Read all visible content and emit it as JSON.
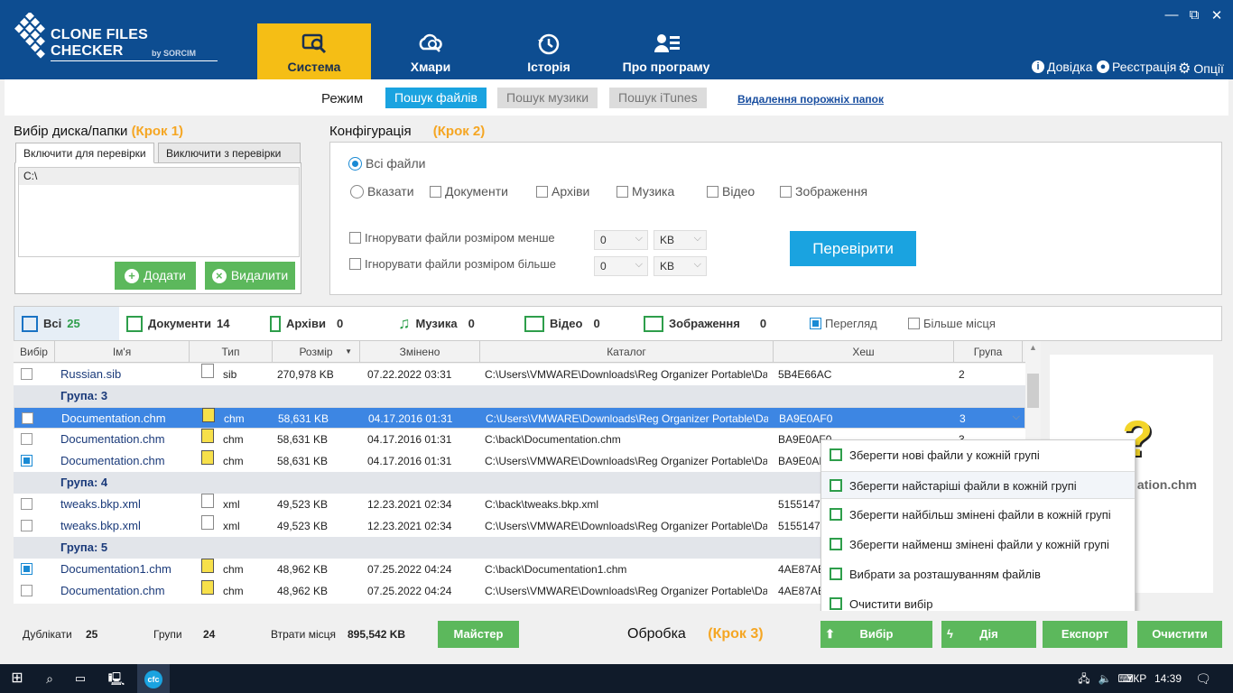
{
  "app": {
    "title": "CLONE FILES CHECKER",
    "subtitle": "by SORCIM"
  },
  "nav": {
    "tabs": [
      {
        "label": "Система",
        "active": true
      },
      {
        "label": "Хмари"
      },
      {
        "label": "Історія"
      },
      {
        "label": "Про програму"
      }
    ]
  },
  "top_links": {
    "help": "Довідка",
    "register": "Реєстрація",
    "options": "Опції"
  },
  "mode": {
    "label": "Режим",
    "buttons": [
      "Пошук файлів",
      "Пошук музики",
      "Пошук iTunes"
    ],
    "link": "Видалення порожніх папок"
  },
  "disk": {
    "title": "Вибір диска/папки",
    "step": "(Крок 1)",
    "tab_include": "Включити для перевірки",
    "tab_exclude": "Виключити з перевірки",
    "paths": [
      "C:\\"
    ],
    "add": "Додати",
    "remove": "Видалити"
  },
  "config": {
    "title": "Конфігурація",
    "step": "(Крок 2)",
    "all_files": "Всі файли",
    "specify": "Вказати",
    "types": [
      "Документи",
      "Архіви",
      "Музика",
      "Відео",
      "Зображення"
    ],
    "ignore_smaller": "Ігнорувати файли розміром менше",
    "ignore_larger": "Ігнорувати файли розміром більше",
    "size_value": "0",
    "size_unit": "KB",
    "scan": "Перевірити"
  },
  "categories": [
    {
      "label": "Всі",
      "count": "25"
    },
    {
      "label": "Документи",
      "count": "14"
    },
    {
      "label": "Архіви",
      "count": "0"
    },
    {
      "label": "Музика",
      "count": "0"
    },
    {
      "label": "Відео",
      "count": "0"
    },
    {
      "label": "Зображення",
      "count": "0"
    }
  ],
  "view": {
    "preview": "Перегляд",
    "more_space": "Більше місця"
  },
  "columns": [
    "Вибір",
    "Ім'я",
    "Тип",
    "Розмір",
    "Змінено",
    "Каталог",
    "Хеш",
    "Група"
  ],
  "rows": [
    {
      "type": "file",
      "checked": false,
      "name": "Russian.sib",
      "ext": "sib",
      "size": "270,978 KB",
      "modified": "07.22.2022 03:31",
      "folder": "C:\\Users\\VMWARE\\Downloads\\Reg Organizer Portable\\Data",
      "hash": "5B4E66AC",
      "group": "2"
    },
    {
      "type": "group",
      "label": "Група: 3"
    },
    {
      "type": "file",
      "checked": false,
      "selected": true,
      "name": "Documentation.chm",
      "ext": "chm",
      "size": "58,631 KB",
      "modified": "04.17.2016 01:31",
      "folder": "C:\\Users\\VMWARE\\Downloads\\Reg Organizer Portable\\Data",
      "hash": "BA9E0AF0",
      "group": "3"
    },
    {
      "type": "file",
      "checked": false,
      "name": "Documentation.chm",
      "ext": "chm",
      "size": "58,631 KB",
      "modified": "04.17.2016 01:31",
      "folder": "C:\\back\\Documentation.chm",
      "hash": "BA9E0AF0",
      "group": "3"
    },
    {
      "type": "file",
      "checked": true,
      "name": "Documentation.chm",
      "ext": "chm",
      "size": "58,631 KB",
      "modified": "04.17.2016 01:31",
      "folder": "C:\\Users\\VMWARE\\Downloads\\Reg Organizer Portable\\Data",
      "hash": "BA9E0AF0",
      "group": "3"
    },
    {
      "type": "group",
      "label": "Група: 4"
    },
    {
      "type": "file",
      "checked": false,
      "name": "tweaks.bkp.xml",
      "ext": "xml",
      "size": "49,523 KB",
      "modified": "12.23.2021 02:34",
      "folder": "C:\\back\\tweaks.bkp.xml",
      "hash": "5155147",
      "group": ""
    },
    {
      "type": "file",
      "checked": false,
      "name": "tweaks.bkp.xml",
      "ext": "xml",
      "size": "49,523 KB",
      "modified": "12.23.2021 02:34",
      "folder": "C:\\Users\\VMWARE\\Downloads\\Reg Organizer Portable\\Data",
      "hash": "5155147",
      "group": ""
    },
    {
      "type": "group",
      "label": "Група: 5"
    },
    {
      "type": "file",
      "checked": true,
      "name": "Documentation1.chm",
      "ext": "chm",
      "size": "48,962 KB",
      "modified": "07.25.2022 04:24",
      "folder": "C:\\back\\Documentation1.chm",
      "hash": "4AE87AE",
      "group": ""
    },
    {
      "type": "file",
      "checked": false,
      "name": "Documentation.chm",
      "ext": "chm",
      "size": "48,962 KB",
      "modified": "07.25.2022 04:24",
      "folder": "C:\\Users\\VMWARE\\Downloads\\Reg Organizer Portable\\Data",
      "hash": "4AE87AE",
      "group": ""
    }
  ],
  "preview": {
    "filename": "ation.chm"
  },
  "context_menu": [
    "Зберегти нові файли у кожній групі",
    "Зберегти найстаріші файли в кожній групі",
    "Зберегти найбільш змінені файли в кожній групі",
    "Зберегти найменш змінені файли у кожній групі",
    "Вибрати за розташуванням файлів",
    "Очистити вибір"
  ],
  "status": {
    "dup_label": "Дублікати",
    "dup_value": "25",
    "groups_label": "Групи",
    "groups_value": "24",
    "loss_label": "Втрати місця",
    "loss_value": "895,542 KB"
  },
  "actions": {
    "wizard": "Майстер",
    "processing": "Обробка",
    "step": "(Крок 3)",
    "select": "Вибір",
    "action": "Дія",
    "export": "Експорт",
    "clear": "Очистити"
  },
  "taskbar": {
    "lang": "УКР",
    "time": "14:39"
  },
  "colors": {
    "header": "#0d4d91",
    "accent": "#f5be15",
    "green": "#5cb85c",
    "blue": "#1aa3e0",
    "selected_row": "#3d86e3"
  }
}
